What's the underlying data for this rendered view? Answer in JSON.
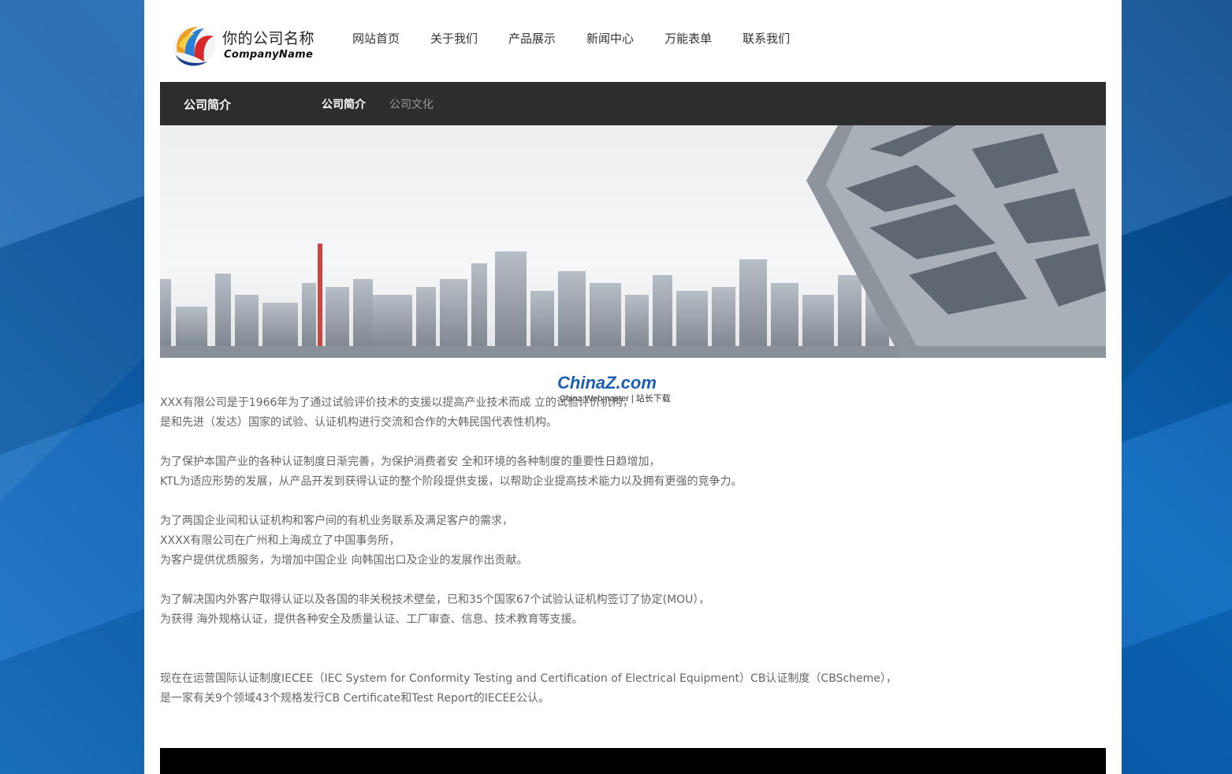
{
  "header": {
    "brand_cn": "你的公司名称",
    "brand_en": "CompanyName",
    "nav": [
      "网站首页",
      "关于我们",
      "产品展示",
      "新闻中心",
      "万能表单",
      "联系我们"
    ]
  },
  "subbar": {
    "section_title": "公司简介",
    "tabs": [
      "公司简介",
      "公司文化"
    ]
  },
  "watermark": {
    "main": "ChinaZ.com",
    "sub": "China Webmaster | 站长下载"
  },
  "content": {
    "p1": "XXX有限公司是于1966年为了通过试验评价技术的支援以提高产业技术而成 立的试验评价机构，",
    "p2": "是和先进（发达）国家的试验、认证机构进行交流和合作的大韩民国代表性机构。",
    "p3": "为了保护本国产业的各种认证制度日渐完善，为保护消费者安 全和环境的各种制度的重要性日趋增加，",
    "p4": "KTL为适应形势的发展，从产品开发到获得认证的整个阶段提供支援，以帮助企业提高技术能力以及拥有更强的竞争力。",
    "p5": "为了两国企业间和认证机构和客户间的有机业务联系及满足客户的需求，",
    "p6": "XXXX有限公司在广州和上海成立了中国事务所，",
    "p7": "为客户提供优质服务，为增加中国企业 向韩国出口及企业的发展作出贡献。",
    "p8": "为了解决国内外客户取得认证以及各国的非关税技术壁垒，已和35个国家67个试验认证机构签订了协定(MOU），",
    "p9": "为获得 海外规格认证，提供各种安全及质量认证、工厂审查、信息、技术教育等支援。",
    "p10": "现在在运营国际认证制度IECEE（IEC System for Conformity Testing and Certification of Electrical Equipment）CB认证制度（CBScheme），",
    "p11": "是一家有关9个领域43个规格发行CB Certificate和Test Report的IECEE公认。"
  }
}
